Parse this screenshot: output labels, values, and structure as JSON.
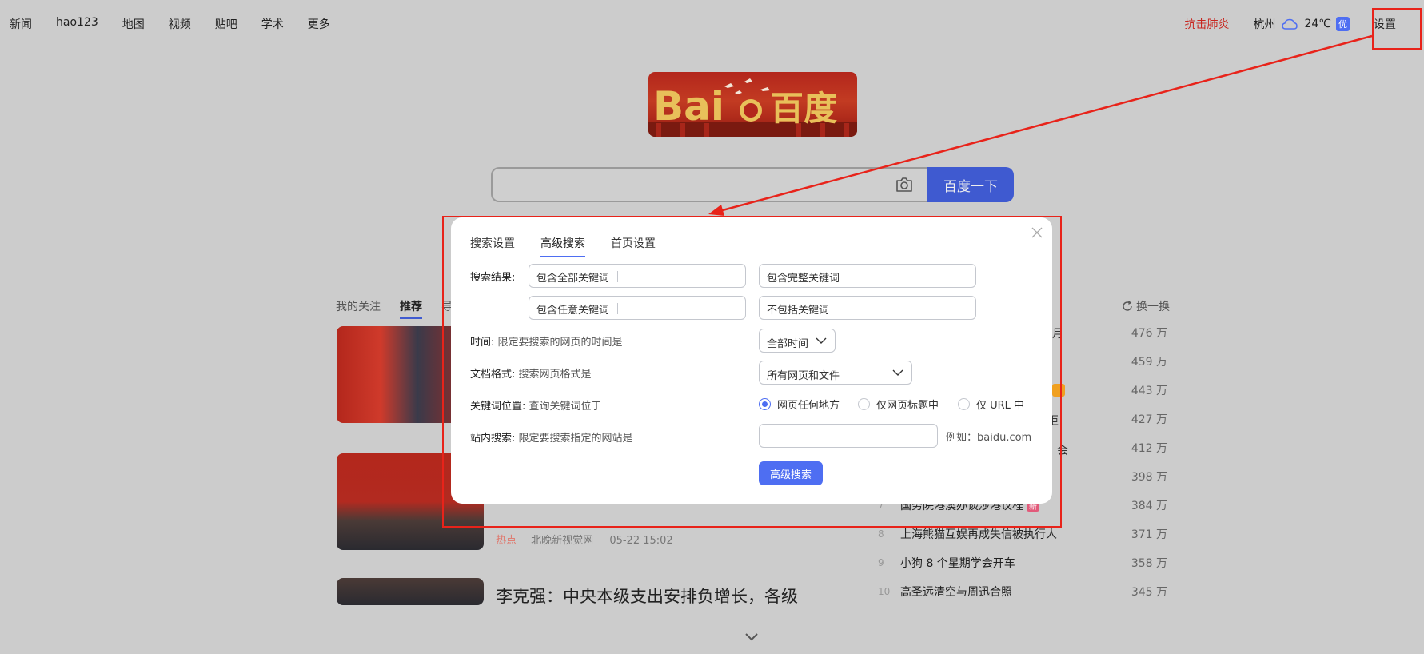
{
  "topnav": {
    "left": [
      "新闻",
      "hao123",
      "地图",
      "视频",
      "贴吧",
      "学术",
      "更多"
    ],
    "hot_link": "抗击肺炎",
    "city": "杭州",
    "temperature": "24℃",
    "air_quality": "优",
    "settings": "设置"
  },
  "search": {
    "button": "百度一下"
  },
  "feed": {
    "tabs": [
      "我的关注",
      "推荐",
      "导"
    ],
    "meta": {
      "tag": "热点",
      "source": "北晚新视觉网",
      "time": "05-22 15:02"
    },
    "headline": "李克强：中央本级支出安排负增长，各级"
  },
  "hot": {
    "refresh": "换一换",
    "partial": {
      "r1": "月",
      "r4": "拒",
      "r5": "会"
    },
    "counts": [
      "476 万",
      "459 万",
      "443 万",
      "427 万",
      "412 万",
      "398 万",
      "384 万",
      "371 万",
      "358 万",
      "345 万"
    ],
    "rows": [
      {
        "num": "7",
        "title": "国务院港澳办谈涉港议程",
        "badge": "新"
      },
      {
        "num": "8",
        "title": "上海熊猫互娱再成失信被执行人"
      },
      {
        "num": "9",
        "title": "小狗 8 个星期学会开车"
      },
      {
        "num": "10",
        "title": "高圣远清空与周迅合照"
      }
    ]
  },
  "modal": {
    "tabs": [
      "搜索设置",
      "高级搜索",
      "首页设置"
    ],
    "active_tab": "高级搜索",
    "results_label": "搜索结果:",
    "inputs": [
      "包含全部关键词",
      "包含完整关键词",
      "包含任意关键词",
      "不包括关键词"
    ],
    "time": {
      "label": "时间:",
      "hint": "限定要搜索的网页的时间是",
      "value": "全部时间"
    },
    "format": {
      "label": "文档格式:",
      "hint": "搜索网页格式是",
      "value": "所有网页和文件"
    },
    "position": {
      "label": "关键词位置:",
      "hint": "查询关键词位于",
      "options": [
        "网页任何地方",
        "仅网页标题中",
        "仅 URL 中"
      ],
      "selected": "网页任何地方"
    },
    "site": {
      "label": "站内搜索:",
      "hint": "限定要搜索指定的网站是",
      "example": "例如：baidu.com"
    },
    "submit": "高级搜索"
  },
  "colors": {
    "accent": "#4e6ef2",
    "annotation": "#e8231a",
    "hot": "#c8261f"
  }
}
